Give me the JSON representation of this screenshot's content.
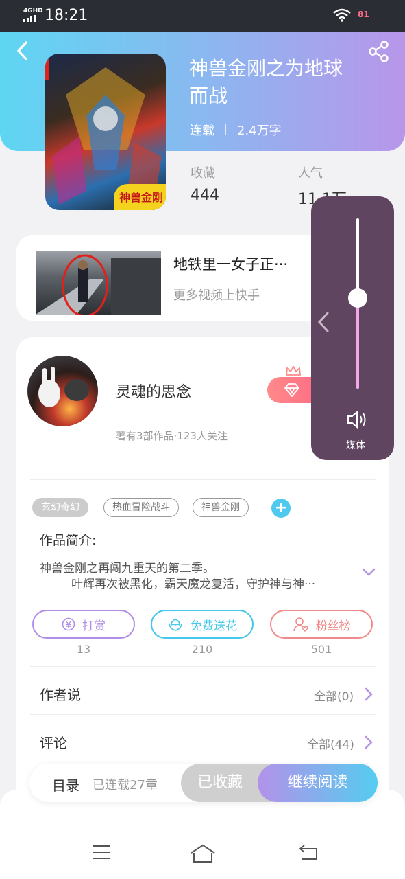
{
  "status_bar": {
    "network": "4GHD",
    "time": "18:21",
    "battery": "81"
  },
  "book": {
    "title_line1": "神兽金刚之为地球",
    "title_line2": "而战",
    "status": "连载",
    "word_count": "2.4万字",
    "cover_badge": "神兽金刚",
    "stats": {
      "favorites_label": "收藏",
      "favorites_value": "444",
      "popularity_label": "人气",
      "popularity_value": "11.1万"
    }
  },
  "video_ad": {
    "title": "地铁里一女子正···",
    "subtitle": "更多视频上快手"
  },
  "author": {
    "name": "灵魂的思念",
    "summary": "著有3部作品·123人关注"
  },
  "tags": [
    "玄幻奇幻",
    "热血冒险战斗",
    "神兽金刚"
  ],
  "intro": {
    "heading": "作品简介:",
    "line1": "神兽金刚之再闯九重天的第二季。",
    "line2": "叶辉再次被黑化，霸天魔龙复活，守护神与神···"
  },
  "actions": [
    {
      "label": "打赏",
      "count": "13",
      "color": "#b08ee6"
    },
    {
      "label": "免费送花",
      "count": "210",
      "color": "#45c8ea"
    },
    {
      "label": "粉丝榜",
      "count": "501",
      "color": "#f08a8a"
    }
  ],
  "sections": {
    "author_says": {
      "label": "作者说",
      "link": "全部(0)"
    },
    "comments": {
      "label": "评论",
      "link": "全部(44)"
    }
  },
  "bottom_bar": {
    "toc_label": "目录",
    "toc_sub": "已连载27章",
    "collected": "已收藏",
    "continue_reading": "继续阅读"
  },
  "volume_overlay": {
    "label": "媒体",
    "level": 0.46
  },
  "icons": [
    "back-icon",
    "share-icon",
    "crown-icon",
    "diamond-icon",
    "yuan-icon",
    "flower-icon",
    "fans-icon",
    "chevron-down-icon",
    "chevron-right-icon",
    "menu-icon",
    "home-icon",
    "return-icon",
    "speaker-icon",
    "chevron-left-icon"
  ]
}
